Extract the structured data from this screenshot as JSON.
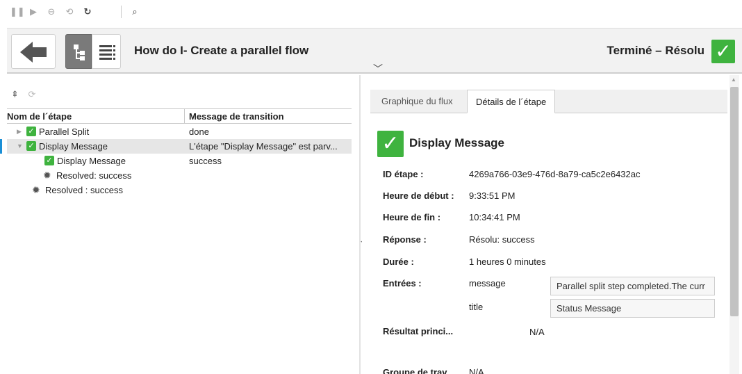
{
  "toolbar": {
    "icons": [
      "pause-icon",
      "step-icon",
      "remove-icon",
      "resolve-icon",
      "refresh-icon",
      "zoom-icon"
    ]
  },
  "header": {
    "title": "How do I- Create a parallel flow",
    "status": "Terminé – Résolu",
    "status_color": "#3fb33f"
  },
  "tree": {
    "columns": [
      "Nom de l´étape",
      "Message de transition"
    ],
    "rows": [
      {
        "label": "Parallel Split",
        "message": "done"
      },
      {
        "label": "Display Message",
        "message": "L'étape \"Display Message\" est parv..."
      },
      {
        "label": "Display Message",
        "message": "success"
      },
      {
        "label": "Resolved: success",
        "message": ""
      },
      {
        "label": "Resolved : success",
        "message": ""
      }
    ],
    "selected_color": "#1a8fd6"
  },
  "tabs": [
    "Graphique du flux",
    "Détails de l´étape"
  ],
  "details": {
    "title": "Display Message",
    "labels": {
      "id": "ID étape :",
      "start": "Heure de début :",
      "end": "Heure de fin :",
      "response": "Réponse :",
      "duration": "Durée :",
      "inputs": "Entrées :",
      "result": "Résultat princi...",
      "group": "Groupe de trav..."
    },
    "values": {
      "id": "4269a766-03e9-476d-8a79-ca5c2e6432ac",
      "start": "9:33:51 PM",
      "end": "10:34:41 PM",
      "response": "Résolu: success",
      "duration": "1 heures 0 minutes",
      "result": "N/A",
      "group": "N/A"
    },
    "inputs": [
      {
        "name": "message",
        "value": "Parallel split step completed.The curr"
      },
      {
        "name": "title",
        "value": "Status Message"
      }
    ]
  }
}
